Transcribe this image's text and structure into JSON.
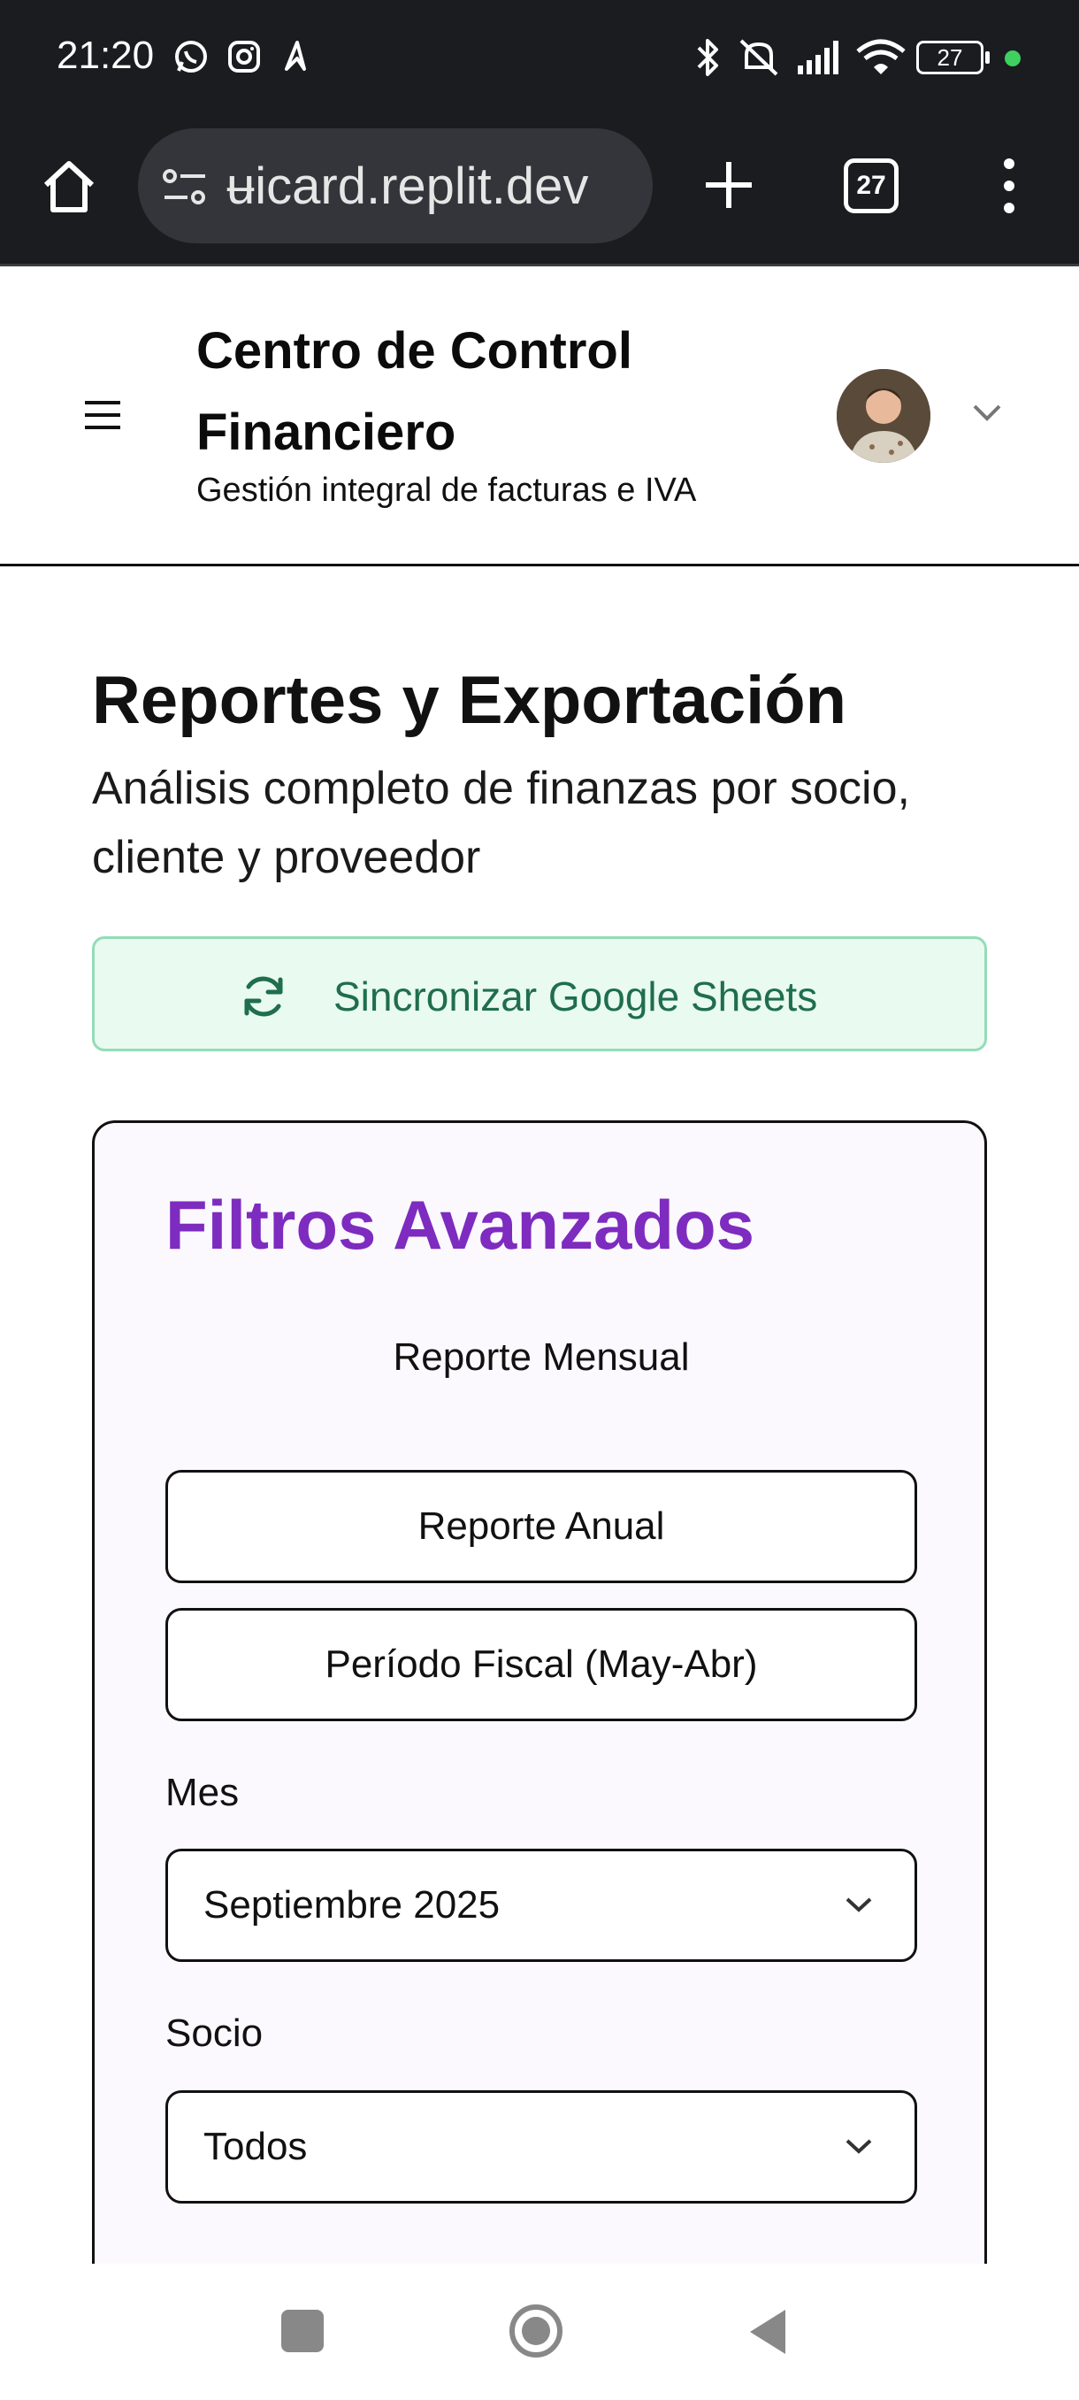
{
  "status_bar": {
    "time": "21:20",
    "battery": "27",
    "icons": [
      "whatsapp-icon",
      "instagram-icon",
      "app-icon",
      "bluetooth-icon",
      "mute-icon",
      "signal-icon",
      "wifi-icon",
      "battery-icon"
    ]
  },
  "browser": {
    "url": "ʉicard.replit.dev",
    "tab_count": "27"
  },
  "header": {
    "title": "Centro de Control Financiero",
    "subtitle": "Gestión integral de facturas e IVA"
  },
  "main": {
    "title": "Reportes y Exportación",
    "subtitle": "Análisis completo de finanzas por socio, cliente y proveedor",
    "sync_label": "Sincronizar Google Sheets"
  },
  "filters": {
    "title": "Filtros Avanzados",
    "report_monthly": "Reporte Mensual",
    "report_annual": "Reporte Anual",
    "report_fiscal": "Período Fiscal (May-Abr)",
    "month_label": "Mes",
    "month_value": "Septiembre 2025",
    "partner_label": "Socio",
    "partner_value": "Todos"
  },
  "colors": {
    "accent_purple": "#7e2bc0",
    "sync_green": "#1f6e4c",
    "sync_bg": "#e9faf1",
    "chrome_dark": "#1b1c1f"
  }
}
